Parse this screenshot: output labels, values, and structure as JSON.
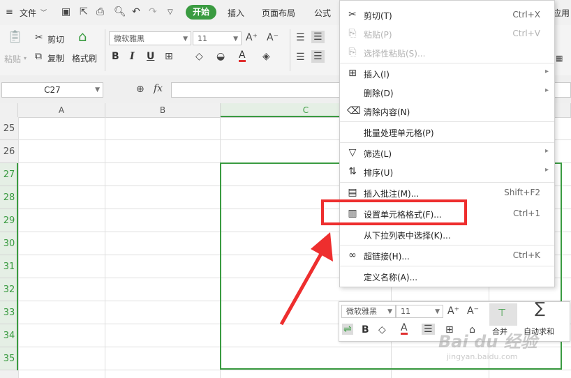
{
  "menubar": {
    "file": "文件",
    "start": "开始",
    "insert": "插入",
    "page_layout": "页面布局",
    "formula": "公式",
    "apps_partial": "应用"
  },
  "ribbon": {
    "cut": "剪切",
    "copy": "复制",
    "paste": "粘贴",
    "format_painter": "格式刷",
    "font_name": "微软雅黑",
    "font_size": "11",
    "bold": "B",
    "italic": "I",
    "underline": "U"
  },
  "formula_bar": {
    "name_box": "C27",
    "fx": "fx"
  },
  "grid": {
    "columns": [
      "A",
      "B",
      "C"
    ],
    "rows": [
      "25",
      "26",
      "27",
      "28",
      "29",
      "30",
      "31",
      "32",
      "33",
      "34",
      "35"
    ]
  },
  "context_menu": {
    "items": [
      {
        "label": "剪切(T)",
        "shortcut": "Ctrl+X",
        "disabled": false
      },
      {
        "label": "粘贴(P)",
        "shortcut": "Ctrl+V",
        "disabled": true
      },
      {
        "label": "选择性粘贴(S)...",
        "shortcut": "",
        "disabled": true
      },
      {
        "label": "插入(I)",
        "shortcut": "",
        "disabled": false
      },
      {
        "label": "删除(D)",
        "shortcut": "",
        "disabled": false
      },
      {
        "label": "清除内容(N)",
        "shortcut": "",
        "disabled": false
      },
      {
        "label": "批量处理单元格(P)",
        "shortcut": "",
        "disabled": false
      },
      {
        "label": "筛选(L)",
        "shortcut": "",
        "disabled": false
      },
      {
        "label": "排序(U)",
        "shortcut": "",
        "disabled": false
      },
      {
        "label": "插入批注(M)...",
        "shortcut": "Shift+F2",
        "disabled": false
      },
      {
        "label": "设置单元格格式(F)...",
        "shortcut": "Ctrl+1",
        "disabled": false
      },
      {
        "label": "从下拉列表中选择(K)...",
        "shortcut": "",
        "disabled": false
      },
      {
        "label": "超链接(H)...",
        "shortcut": "Ctrl+K",
        "disabled": false
      },
      {
        "label": "定义名称(A)...",
        "shortcut": "",
        "disabled": false
      }
    ]
  },
  "mini_toolbar": {
    "font_name": "微软雅黑",
    "font_size": "11",
    "bold": "B",
    "merge": "合并",
    "autosum": "自动求和"
  },
  "watermark": {
    "brand": "Bai du 经验",
    "url": "jingyan.baidu.com"
  },
  "colors": {
    "accent_green": "#3a9b41",
    "highlight_red": "#ee2e2e"
  }
}
